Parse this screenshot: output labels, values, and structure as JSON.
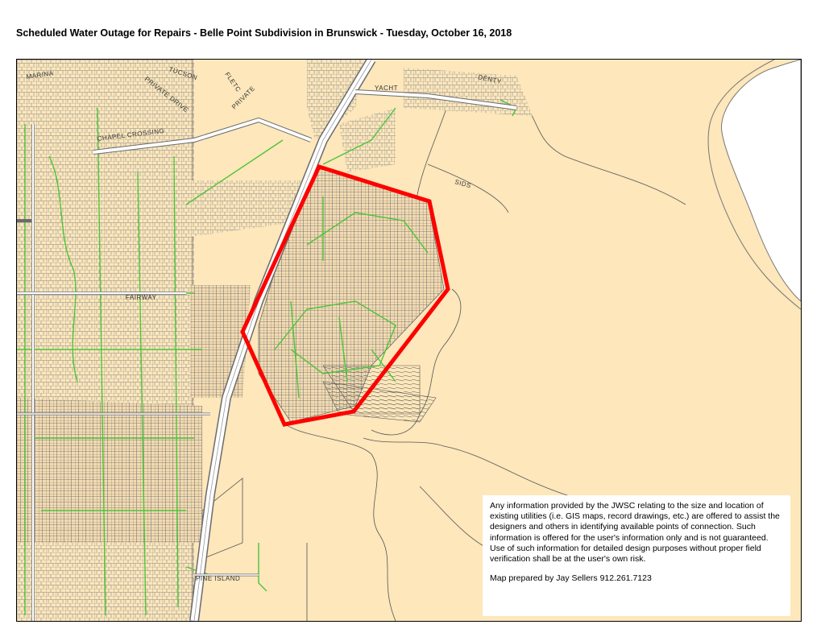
{
  "title": "Scheduled Water Outage for Repairs - Belle Point Subdivision in Brunswick - Tuesday, October 16, 2018",
  "map": {
    "colors": {
      "land": "#fde7bb",
      "water": "#ffffff",
      "parcel_line": "#6b6b6b",
      "water_main": "#4cc43a",
      "outage_boundary": "#ff0000"
    },
    "street_labels": {
      "marina": "MARINA",
      "tucson": "TUCSON",
      "private_drive": "PRIVATE DRIVE",
      "fletc": "FLETC",
      "private": "PRIVATE",
      "yacht": "YACHT",
      "denty": "DENTY",
      "chapel_crossing": "CHAPEL CROSSING",
      "sids": "SIDS",
      "fairway": "FAIRWAY",
      "pine_island": "PINE ISLAND"
    }
  },
  "disclaimer": {
    "text": "Any information provided by the JWSC relating to the size and location of existing utilities (i.e. GIS maps, record drawings, etc.) are offered to assist the designers and others in identifying available points of connection. Such information is offered for the user's information only and is not guaranteed. Use of such information for detailed design purposes without proper field verification shall be at the user's own risk.",
    "credit": "Map prepared by Jay Sellers 912.261.7123"
  }
}
